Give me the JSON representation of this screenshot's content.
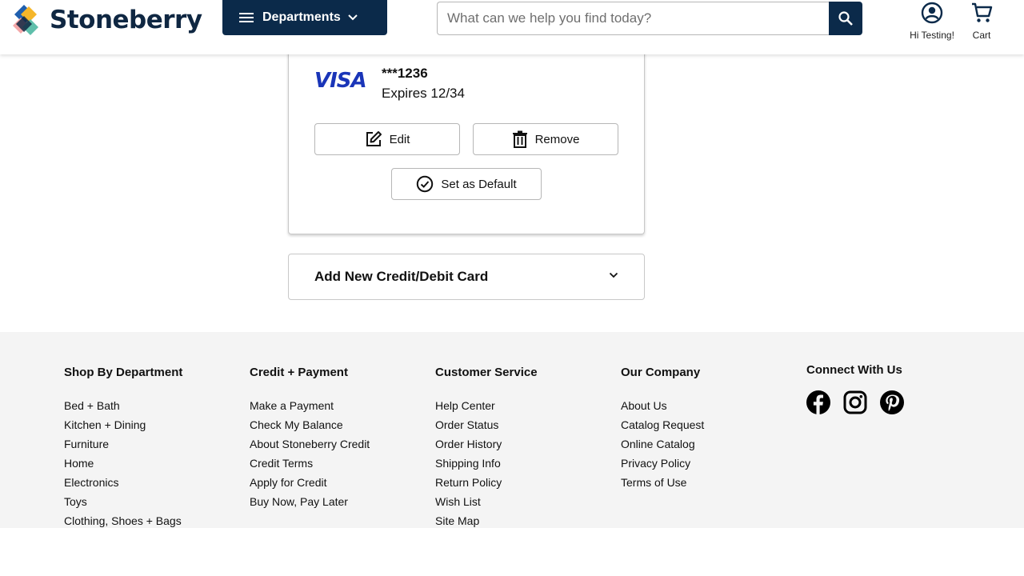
{
  "header": {
    "logo_text": "Stoneberry",
    "departments_label": "Departments",
    "search_placeholder": "What can we help you find today?",
    "account_label": "Hi Testing!",
    "cart_label": "Cart"
  },
  "card": {
    "brand": "VISA",
    "number": "***1236",
    "expires": "Expires 12/34",
    "edit_label": "Edit",
    "remove_label": "Remove",
    "default_label": "Set as Default"
  },
  "add_card": {
    "label": "Add New Credit/Debit Card"
  },
  "footer": {
    "columns": [
      {
        "title": "Shop By Department",
        "links": [
          "Bed + Bath",
          "Kitchen + Dining",
          "Furniture",
          "Home",
          "Electronics",
          "Toys",
          "Clothing, Shoes + Bags"
        ]
      },
      {
        "title": "Credit + Payment",
        "links": [
          "Make a Payment",
          "Check My Balance",
          "About Stoneberry Credit",
          "Credit Terms",
          "Apply for Credit",
          "Buy Now, Pay Later"
        ]
      },
      {
        "title": "Customer Service",
        "links": [
          "Help Center",
          "Order Status",
          "Order History",
          "Shipping Info",
          "Return Policy",
          "Wish List",
          "Site Map"
        ]
      },
      {
        "title": "Our Company",
        "links": [
          "About Us",
          "Catalog Request",
          "Online Catalog",
          "Privacy Policy",
          "Terms of Use"
        ]
      }
    ],
    "connect_title": "Connect With Us",
    "social_icons": [
      "facebook-icon",
      "instagram-icon",
      "pinterest-icon"
    ]
  },
  "colors": {
    "brand_navy": "#0b2a4a",
    "visa_blue": "#1a35b8",
    "footer_bg": "#f4f4f4"
  }
}
